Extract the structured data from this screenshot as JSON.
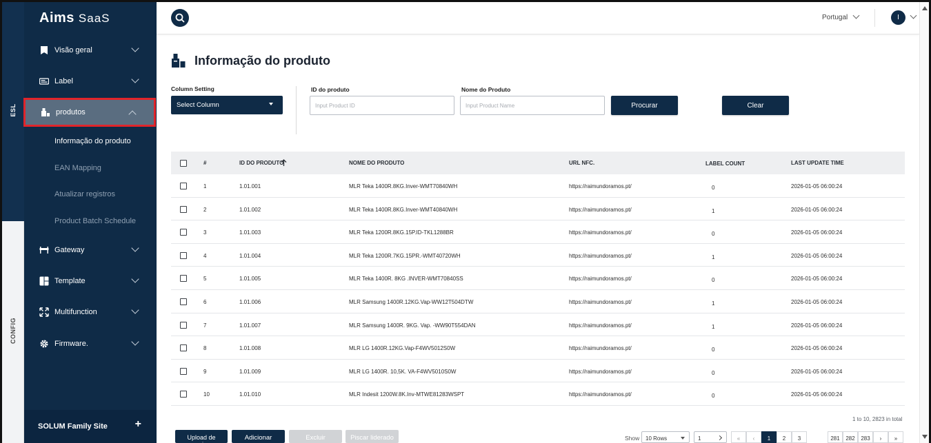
{
  "rail": {
    "esl": "ESL",
    "config": "CONFIG"
  },
  "brand": {
    "name": "Aims",
    "suffix": "SaaS"
  },
  "sidebar": {
    "items": [
      {
        "label": "Visão geral"
      },
      {
        "label": "Label"
      },
      {
        "label": "produtos"
      },
      {
        "label": "Gateway"
      },
      {
        "label": "Template"
      },
      {
        "label": "Multifunction"
      },
      {
        "label": "Firmware."
      }
    ],
    "subitems": [
      {
        "label": "Informação do produto"
      },
      {
        "label": "EAN Mapping"
      },
      {
        "label": "Atualizar registros"
      },
      {
        "label": "Product Batch Schedule"
      }
    ],
    "family": "SOLUM Family Site",
    "family_plus": "+"
  },
  "topbar": {
    "language": "Portugal",
    "avatar_initial": "I"
  },
  "page": {
    "title": "Informação do produto"
  },
  "filters": {
    "column_setting_label": "Column Setting",
    "select_column": "Select Column",
    "product_id_label": "ID do produto",
    "product_id_placeholder": "Input Product ID",
    "product_name_label": "Nome do Produto",
    "product_name_placeholder": "Input Product Name",
    "search_button": "Procurar",
    "clear_button": "Clear"
  },
  "table": {
    "headers": {
      "index": "#",
      "product_id": "ID DO PRODUTO",
      "product_name": "NOME DO PRODUTO",
      "url": "URL NFC.",
      "label_count": "LABEL COUNT",
      "last_update": "LAST UPDATE TIME"
    },
    "rows": [
      {
        "n": "1",
        "id": "1.01.001",
        "name": "MLR Teka 1400R.8KG.Inver-WMT70840WH",
        "url": "https://raimundoramos.pt/",
        "count": "0",
        "time": "2026-01-05 06:00:24"
      },
      {
        "n": "2",
        "id": "1.01.002",
        "name": "MLR Teka 1400R.8KG.Inver-WMT40840WH",
        "url": "https://raimundoramos.pt/",
        "count": "1",
        "time": "2026-01-05 06:00:24"
      },
      {
        "n": "3",
        "id": "1.01.003",
        "name": "MLR Teka 1200R.8KG.15P.ID-TKL1288BR",
        "url": "https://raimundoramos.pt/",
        "count": "0",
        "time": "2026-01-05 06:00:24"
      },
      {
        "n": "4",
        "id": "1.01.004",
        "name": "MLR Teka 1200R.7KG.15PR.-WMT40720WH",
        "url": "https://raimundoramos.pt/",
        "count": "1",
        "time": "2026-01-05 06:00:24"
      },
      {
        "n": "5",
        "id": "1.01.005",
        "name": "MLR Teka 1400R. 8KG .INVER-WMT70840SS",
        "url": "https://raimundoramos.pt/",
        "count": "0",
        "time": "2026-01-05 06:00:24"
      },
      {
        "n": "6",
        "id": "1.01.006",
        "name": "MLR Samsung 1400R.12KG.Vap-WW12T504DTW",
        "url": "https://raimundoramos.pt/",
        "count": "1",
        "time": "2026-01-05 06:00:24"
      },
      {
        "n": "7",
        "id": "1.01.007",
        "name": "MLR Samsung 1400R. 9KG. Vap. -WW90T554DAN",
        "url": "https://raimundoramos.pt/",
        "count": "1",
        "time": "2026-01-05 06:00:24"
      },
      {
        "n": "8",
        "id": "1.01.008",
        "name": "MLR LG 1400R.12KG.Vap-F4WV5012S0W",
        "url": "https://raimundoramos.pt/",
        "count": "0",
        "time": "2026-01-05 06:00:24"
      },
      {
        "n": "9",
        "id": "1.01.009",
        "name": "MLR LG 1400R. 10,5K. VA-F4WV5010S0W",
        "url": "https://raimundoramos.pt/",
        "count": "0",
        "time": "2026-01-05 06:00:24"
      },
      {
        "n": "10",
        "id": "1.01.010",
        "name": "MLR Indesit 1200W.8K.Inv-MTWE81283WSPT",
        "url": "https://raimundoramos.pt/",
        "count": "0",
        "time": "2026-01-05 06:00:24"
      }
    ],
    "total_text": "1 to 10, 2823 in total"
  },
  "actions": {
    "upload": "Upload de arquivos",
    "add": "Adicionar",
    "delete": "Excluir",
    "blink": "Piscar liderado"
  },
  "pagination": {
    "show_label": "Show",
    "rows_option": "10 Rows",
    "page_input": "1",
    "first": "«",
    "prev": "‹",
    "next": "›",
    "last": "»",
    "pages": [
      "1",
      "2",
      "3"
    ],
    "tail_pages": [
      "281",
      "282",
      "283"
    ]
  },
  "colors": {
    "sidebar": "#0f2b47",
    "active_item": "#5a6d80",
    "highlight": "#e0242a"
  }
}
